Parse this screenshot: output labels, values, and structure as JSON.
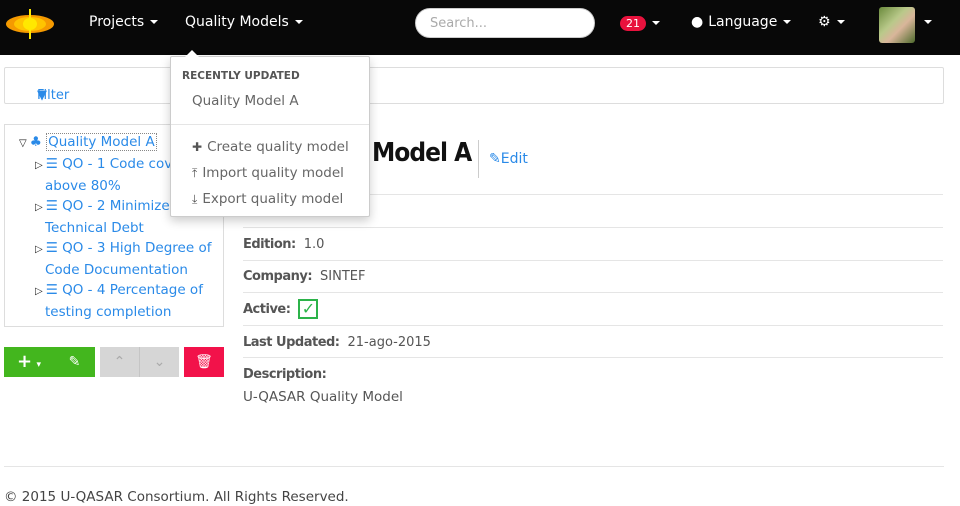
{
  "navbar": {
    "logo": "sun-logo",
    "menus": [
      {
        "label": "Projects"
      },
      {
        "label": "Quality Models"
      }
    ],
    "search_placeholder": "Search...",
    "notifications_count": "21",
    "language_label": "Language",
    "settings_icon": "gears-icon",
    "avatar": "user-avatar"
  },
  "quality_models_menu": {
    "header": "RECENTLY UPDATED",
    "recent": [
      "Quality Model A"
    ],
    "actions": [
      {
        "icon": "plus-icon",
        "label": "Create quality model"
      },
      {
        "icon": "upload-icon",
        "label": "Import quality model"
      },
      {
        "icon": "download-icon",
        "label": "Export quality model"
      }
    ]
  },
  "filter": {
    "label": "Filter"
  },
  "tree": {
    "root": "Quality Model A",
    "children": [
      {
        "line1": "QO - 1 Code cov",
        "line2": "above 80%"
      },
      {
        "line1": "QO - 2 Minimize",
        "line2": "Technical Debt"
      },
      {
        "line1": "QO - 3 High Degree of",
        "line2": "Code Documentation"
      },
      {
        "line1": "QO - 4 Percentage of",
        "line2": "testing completion"
      }
    ]
  },
  "tree_buttons": {
    "add": "+",
    "colors": {
      "green": "#43b61e",
      "gray": "#d6d6d6",
      "red": "#f2124a"
    }
  },
  "detail": {
    "title": "Model A",
    "edit_label": "Edit",
    "properties": [
      {
        "label": "Edition:",
        "value": "1.0"
      },
      {
        "label": "Company:",
        "value": "SINTEF"
      },
      {
        "label": "Active:",
        "value": "true"
      },
      {
        "label": "Last Updated:",
        "value": "21-ago-2015"
      },
      {
        "label": "Description:",
        "value": "U-QASAR Quality Model"
      }
    ]
  },
  "footer": {
    "text": "© 2015 U-QASAR Consortium. All Rights Reserved."
  }
}
